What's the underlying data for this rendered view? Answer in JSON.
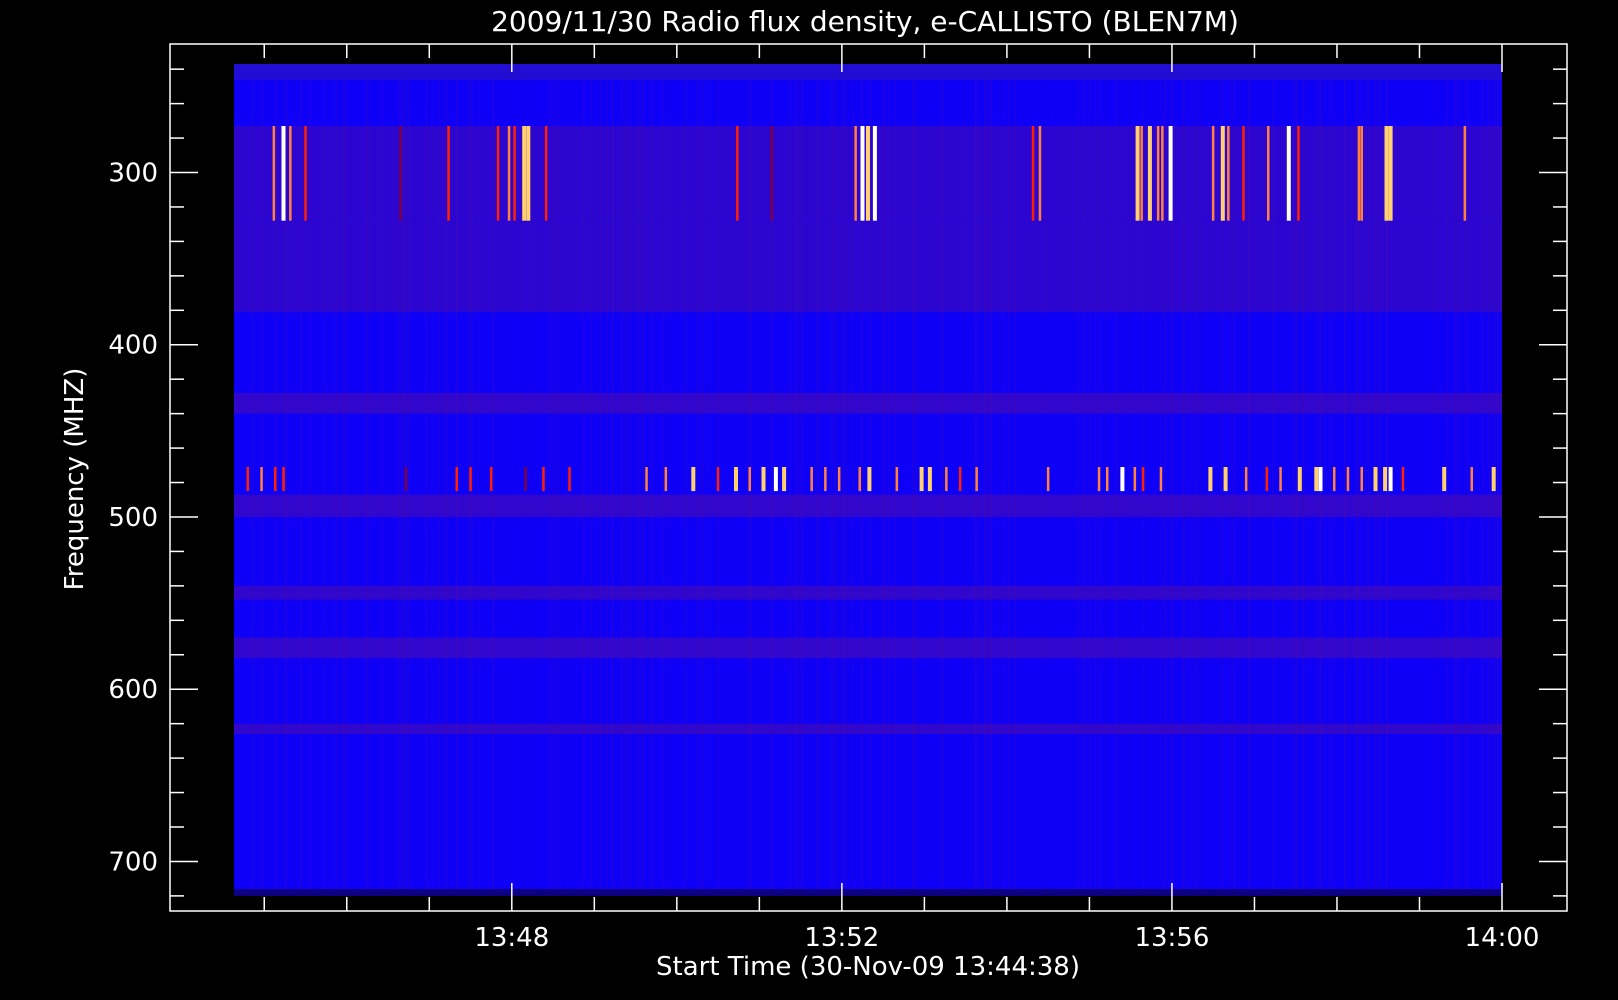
{
  "chart_data": {
    "type": "heatmap",
    "title": "2009/11/30  Radio flux density, e-CALLISTO (BLEN7M)",
    "xlabel": "Start Time (30-Nov-09 13:44:38)",
    "ylabel": "Frequency (MHZ)",
    "x_range": [
      "13:44:38",
      "14:00:00"
    ],
    "xlim": [
      "13:44:38",
      "14:00:00"
    ],
    "ylim": [
      237,
      716
    ],
    "y_inverted": true,
    "x_ticks": [
      "13:48",
      "13:52",
      "13:56",
      "14:00"
    ],
    "y_ticks": [
      300,
      400,
      500,
      600,
      700
    ],
    "colormap": [
      "#0000ff",
      "#7f0040",
      "#ff2000",
      "#ff8040",
      "#ffd070",
      "#ffffff"
    ],
    "background_color": "#0000ff",
    "frequency_bands": [
      {
        "from_mhz": 246,
        "to_mhz": 273,
        "level": "low"
      },
      {
        "from_mhz": 273,
        "to_mhz": 328,
        "level": "moderate"
      },
      {
        "from_mhz": 328,
        "to_mhz": 381,
        "level": "moderate"
      },
      {
        "from_mhz": 381,
        "to_mhz": 720,
        "level": "low"
      },
      {
        "from_mhz": 428,
        "to_mhz": 440,
        "level": "moderate"
      },
      {
        "from_mhz": 487,
        "to_mhz": 500,
        "level": "moderate"
      },
      {
        "from_mhz": 540,
        "to_mhz": 548,
        "level": "moderate"
      },
      {
        "from_mhz": 570,
        "to_mhz": 582,
        "level": "moderate"
      },
      {
        "from_mhz": 620,
        "to_mhz": 626,
        "level": "moderate"
      }
    ],
    "bursts_band_1": {
      "freq_range": [
        273,
        328
      ],
      "times": [
        "13:45:07",
        "13:45:14",
        "13:45:19",
        "13:45:30",
        "13:46:39",
        "13:47:14",
        "13:47:50",
        "13:47:58",
        "13:48:02",
        "13:48:09",
        "13:48:12",
        "13:48:25",
        "13:50:44",
        "13:51:09",
        "13:52:10",
        "13:52:15",
        "13:52:19",
        "13:52:24",
        "13:54:19",
        "13:54:24",
        "13:55:35",
        "13:55:38",
        "13:55:44",
        "13:55:50",
        "13:55:53",
        "13:55:59",
        "13:56:30",
        "13:56:37",
        "13:56:41",
        "13:56:52",
        "13:57:10",
        "13:57:25",
        "13:57:32",
        "13:58:16",
        "13:58:18",
        "13:58:36",
        "13:58:39",
        "13:59:33"
      ],
      "intensity": [
        0.8,
        0.95,
        0.7,
        0.5,
        0.4,
        0.5,
        0.65,
        0.8,
        0.55,
        0.85,
        0.9,
        0.6,
        0.5,
        0.45,
        0.75,
        0.95,
        0.85,
        1.0,
        0.55,
        0.8,
        0.85,
        0.7,
        0.9,
        0.75,
        0.8,
        0.95,
        0.7,
        0.9,
        0.8,
        0.5,
        0.75,
        0.98,
        0.5,
        0.8,
        0.7,
        0.85,
        0.9,
        0.75
      ]
    },
    "bursts_band_2": {
      "freq_range": [
        471,
        485
      ],
      "times": [
        "13:44:48",
        "13:44:58",
        "13:45:08",
        "13:45:14",
        "13:46:43",
        "13:47:20",
        "13:47:30",
        "13:47:45",
        "13:48:10",
        "13:48:23",
        "13:48:42",
        "13:49:38",
        "13:49:52",
        "13:50:12",
        "13:50:30",
        "13:50:43",
        "13:50:53",
        "13:51:03",
        "13:51:12",
        "13:51:18",
        "13:51:38",
        "13:51:48",
        "13:51:58",
        "13:52:13",
        "13:52:20",
        "13:52:40",
        "13:52:58",
        "13:53:04",
        "13:53:16",
        "13:53:26",
        "13:53:38",
        "13:54:30",
        "13:55:07",
        "13:55:13",
        "13:55:24",
        "13:55:33",
        "13:55:39",
        "13:55:52",
        "13:56:28",
        "13:56:39",
        "13:56:54",
        "13:57:09",
        "13:57:19",
        "13:57:33",
        "13:57:45",
        "13:57:48",
        "13:57:58",
        "13:58:08",
        "13:58:18",
        "13:58:28",
        "13:58:35",
        "13:58:39",
        "13:58:48",
        "13:59:18",
        "13:59:38",
        "13:59:54"
      ],
      "intensity": [
        0.5,
        0.7,
        0.6,
        0.5,
        0.4,
        0.5,
        0.5,
        0.6,
        0.4,
        0.5,
        0.6,
        0.7,
        0.8,
        0.9,
        0.6,
        0.9,
        0.7,
        0.85,
        0.95,
        0.9,
        0.7,
        0.75,
        0.8,
        0.7,
        0.9,
        0.8,
        0.9,
        0.85,
        0.7,
        0.6,
        0.7,
        0.8,
        0.75,
        0.7,
        0.95,
        0.8,
        0.6,
        0.8,
        0.9,
        0.85,
        0.7,
        0.6,
        0.8,
        0.9,
        0.85,
        0.95,
        0.7,
        0.8,
        0.75,
        0.9,
        0.85,
        0.95,
        0.6,
        0.9,
        0.8,
        0.85
      ]
    }
  }
}
